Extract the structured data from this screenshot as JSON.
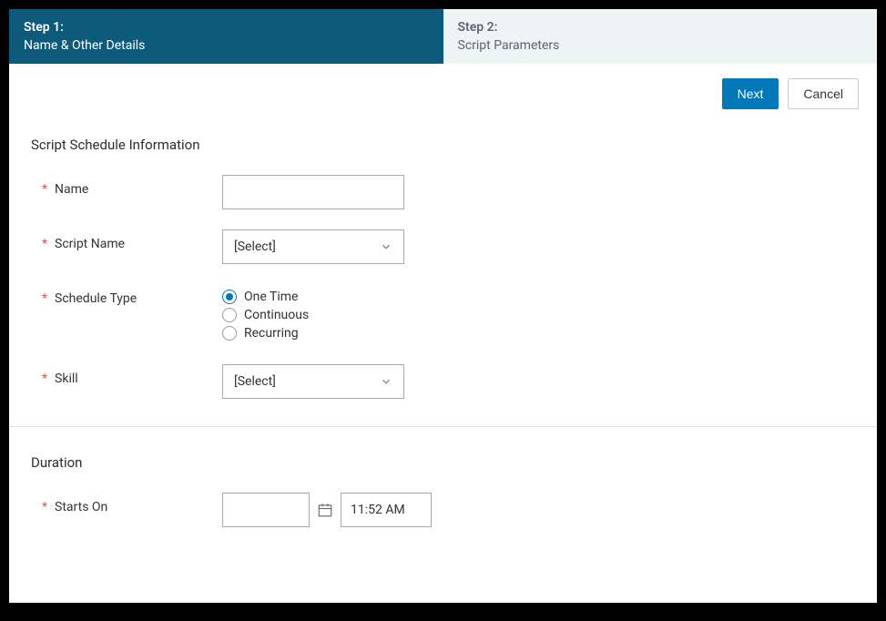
{
  "steps": {
    "step1_title": "Step 1:",
    "step1_subtitle": "Name & Other Details",
    "step2_title": "Step 2:",
    "step2_subtitle": "Script Parameters"
  },
  "buttons": {
    "next": "Next",
    "cancel": "Cancel"
  },
  "section1": {
    "title": "Script Schedule Information",
    "name_label": "Name",
    "name_value": "",
    "script_name_label": "Script Name",
    "script_name_selected": "[Select]",
    "schedule_type_label": "Schedule Type",
    "schedule_options": {
      "one_time": "One Time",
      "continuous": "Continuous",
      "recurring": "Recurring"
    },
    "skill_label": "Skill",
    "skill_selected": "[Select]"
  },
  "section2": {
    "title": "Duration",
    "starts_on_label": "Starts On",
    "date_value": "",
    "time_value": "11:52 AM"
  }
}
